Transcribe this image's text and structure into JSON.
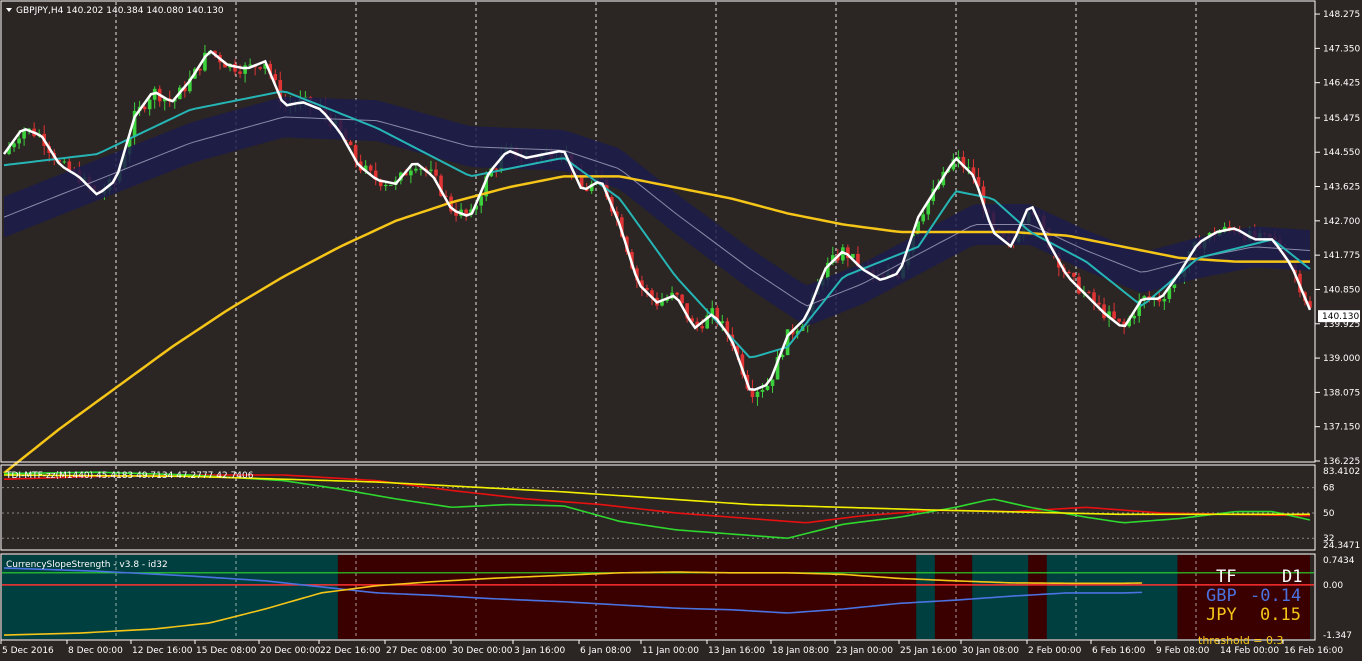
{
  "chart_data": [
    {
      "type": "candlestick",
      "pane": "main",
      "title": "GBPJPY,H4  140.202 140.384 140.080 140.130",
      "ylim": [
        136.225,
        148.6
      ],
      "yticks": [
        "148.275",
        "147.350",
        "146.425",
        "145.475",
        "144.550",
        "143.625",
        "142.700",
        "141.775",
        "140.850",
        "139.925",
        "139.000",
        "138.075",
        "137.150",
        "136.225"
      ],
      "yticks_values": [
        148.275,
        147.35,
        146.425,
        145.475,
        144.55,
        143.625,
        142.7,
        141.775,
        140.85,
        139.925,
        139.0,
        138.075,
        137.15,
        136.225
      ],
      "current_price": "140.130",
      "current_price_value": 140.13,
      "price_path": [
        [
          0,
          144.5
        ],
        [
          1,
          145.2
        ],
        [
          2,
          145.0
        ],
        [
          3,
          144.2
        ],
        [
          4,
          143.9
        ],
        [
          5,
          143.4
        ],
        [
          6,
          143.8
        ],
        [
          7,
          145.5
        ],
        [
          8,
          146.2
        ],
        [
          9,
          145.9
        ],
        [
          10,
          146.5
        ],
        [
          11,
          147.3
        ],
        [
          12,
          146.9
        ],
        [
          13,
          146.8
        ],
        [
          14,
          147.0
        ],
        [
          15,
          145.8
        ],
        [
          16,
          145.9
        ],
        [
          17,
          145.7
        ],
        [
          18,
          145.1
        ],
        [
          19,
          144.2
        ],
        [
          20,
          143.8
        ],
        [
          21,
          143.7
        ],
        [
          22,
          144.3
        ],
        [
          23,
          143.9
        ],
        [
          24,
          143.0
        ],
        [
          25,
          142.8
        ],
        [
          26,
          144.0
        ],
        [
          27,
          144.6
        ],
        [
          28,
          144.4
        ],
        [
          29,
          144.5
        ],
        [
          30,
          144.6
        ],
        [
          31,
          143.5
        ],
        [
          32,
          143.8
        ],
        [
          33,
          142.6
        ],
        [
          34,
          141.0
        ],
        [
          35,
          140.5
        ],
        [
          36,
          140.7
        ],
        [
          37,
          139.8
        ],
        [
          38,
          140.2
        ],
        [
          39,
          139.5
        ],
        [
          40,
          138.1
        ],
        [
          41,
          138.3
        ],
        [
          42,
          139.6
        ],
        [
          43,
          140.1
        ],
        [
          44,
          141.4
        ],
        [
          45,
          141.9
        ],
        [
          46,
          141.4
        ],
        [
          47,
          141.1
        ],
        [
          48,
          141.3
        ],
        [
          49,
          142.8
        ],
        [
          50,
          143.6
        ],
        [
          51,
          144.4
        ],
        [
          52,
          143.9
        ],
        [
          53,
          142.4
        ],
        [
          54,
          142.0
        ],
        [
          55,
          143.2
        ],
        [
          56,
          142.1
        ],
        [
          57,
          141.2
        ],
        [
          58,
          140.7
        ],
        [
          59,
          140.2
        ],
        [
          60,
          139.8
        ],
        [
          61,
          140.6
        ],
        [
          62,
          140.6
        ],
        [
          63,
          141.3
        ],
        [
          64,
          142.1
        ],
        [
          65,
          142.4
        ],
        [
          66,
          142.5
        ],
        [
          67,
          142.2
        ],
        [
          68,
          142.2
        ],
        [
          69,
          141.5
        ],
        [
          70,
          140.3
        ]
      ],
      "series": [
        {
          "values": [
            [
              0,
              144.2
            ],
            [
              5,
              144.5
            ],
            [
              10,
              145.7
            ],
            [
              15,
              146.2
            ],
            [
              20,
              145.2
            ],
            [
              25,
              143.9
            ],
            [
              30,
              144.4
            ],
            [
              33,
              143.3
            ],
            [
              36,
              141.2
            ],
            [
              40,
              139.0
            ],
            [
              42,
              139.3
            ],
            [
              45,
              141.2
            ],
            [
              49,
              142.0
            ],
            [
              51,
              143.5
            ],
            [
              53,
              143.3
            ],
            [
              55,
              142.4
            ],
            [
              58,
              141.6
            ],
            [
              61,
              140.4
            ],
            [
              64,
              141.7
            ],
            [
              68,
              142.2
            ],
            [
              70,
              141.4
            ]
          ],
          "color": "#26b5b5"
        },
        {
          "values": [
            [
              0,
              142.8
            ],
            [
              5,
              143.8
            ],
            [
              10,
              144.8
            ],
            [
              15,
              145.5
            ],
            [
              20,
              145.4
            ],
            [
              25,
              144.7
            ],
            [
              30,
              144.6
            ],
            [
              33,
              144.1
            ],
            [
              36,
              142.9
            ],
            [
              40,
              141.4
            ],
            [
              43,
              140.4
            ],
            [
              46,
              141.0
            ],
            [
              49,
              141.8
            ],
            [
              52,
              142.6
            ],
            [
              55,
              142.6
            ],
            [
              58,
              141.9
            ],
            [
              61,
              141.3
            ],
            [
              64,
              141.7
            ],
            [
              67,
              142.0
            ],
            [
              70,
              141.9
            ]
          ],
          "color": "#1c1c4c"
        },
        {
          "values": [
            [
              0,
              135.9
            ],
            [
              3,
              137.1
            ],
            [
              6,
              138.2
            ],
            [
              9,
              139.3
            ],
            [
              12,
              140.3
            ],
            [
              15,
              141.2
            ],
            [
              18,
              142.0
            ],
            [
              21,
              142.7
            ],
            [
              24,
              143.2
            ],
            [
              27,
              143.6
            ],
            [
              30,
              143.9
            ],
            [
              33,
              143.9
            ],
            [
              36,
              143.6
            ],
            [
              39,
              143.3
            ],
            [
              42,
              142.9
            ],
            [
              45,
              142.6
            ],
            [
              48,
              142.4
            ],
            [
              51,
              142.4
            ],
            [
              54,
              142.4
            ],
            [
              57,
              142.3
            ],
            [
              60,
              142.0
            ],
            [
              63,
              141.7
            ],
            [
              66,
              141.6
            ],
            [
              70,
              141.6
            ]
          ],
          "color": "#f5c518"
        }
      ],
      "xticks": [
        "5 Dec 2016",
        "8 Dec 00:00",
        "12 Dec 16:00",
        "15 Dec 08:00",
        "20 Dec 00:00",
        "22 Dec 16:00",
        "27 Dec 08:00",
        "30 Dec 00:00",
        "3 Jan 16:00",
        "6 Jan 08:00",
        "11 Jan 00:00",
        "13 Jan 16:00",
        "18 Jan 08:00",
        "23 Jan 00:00",
        "25 Jan 16:00",
        "30 Jan 08:00",
        "2 Feb 00:00",
        "6 Feb 16:00",
        "9 Feb 08:00",
        "14 Feb 00:00",
        "16 Feb 16:00"
      ]
    },
    {
      "type": "line",
      "pane": "indicator",
      "title": "TDI-MTF-zz(M1440) 45.4183 49.7134 47.2777 42.7406",
      "yticks": [
        "83.4102",
        "68",
        "50",
        "32",
        "24.3471"
      ],
      "yticks_values": [
        83.4102,
        68,
        50,
        32,
        24.3471
      ],
      "ylim": [
        24.3471,
        83.4102
      ],
      "series": [
        {
          "values": [
            [
              0,
              74
            ],
            [
              5,
              76
            ],
            [
              10,
              77
            ],
            [
              15,
              77
            ],
            [
              20,
              73
            ],
            [
              24,
              66
            ],
            [
              28,
              60
            ],
            [
              32,
              56
            ],
            [
              36,
              50
            ],
            [
              40,
              46
            ],
            [
              43,
              43
            ],
            [
              46,
              48
            ],
            [
              50,
              52
            ],
            [
              54,
              51
            ],
            [
              58,
              54
            ],
            [
              62,
              50
            ],
            [
              66,
              49
            ],
            [
              70,
              48
            ]
          ],
          "color": "#e81010"
        },
        {
          "values": [
            [
              0,
              78
            ],
            [
              5,
              79
            ],
            [
              10,
              77
            ],
            [
              15,
              73
            ],
            [
              18,
              67
            ],
            [
              21,
              60
            ],
            [
              24,
              54
            ],
            [
              27,
              56
            ],
            [
              30,
              55
            ],
            [
              33,
              44
            ],
            [
              36,
              38
            ],
            [
              40,
              34
            ],
            [
              42,
              32
            ],
            [
              45,
              42
            ],
            [
              48,
              47
            ],
            [
              51,
              54
            ],
            [
              53,
              60
            ],
            [
              55,
              54
            ],
            [
              58,
              47
            ],
            [
              60,
              43
            ],
            [
              63,
              46
            ],
            [
              66,
              51
            ],
            [
              68,
              51
            ],
            [
              70,
              45
            ]
          ],
          "color": "#2ed82e"
        },
        {
          "values": [
            [
              0,
              77
            ],
            [
              10,
              76
            ],
            [
              20,
              72
            ],
            [
              30,
              65
            ],
            [
              40,
              56
            ],
            [
              50,
              52
            ],
            [
              60,
              49
            ],
            [
              70,
              49
            ]
          ],
          "color": "#f2f000"
        }
      ]
    },
    {
      "type": "line",
      "pane": "currency-slope",
      "title": "CurrencySlopeStrength - v3.8 - id32",
      "yticks": [
        "0.7434",
        "0.00",
        "-1.347"
      ],
      "yticks_values": [
        0.7434,
        0.0,
        -1.347
      ],
      "ylim": [
        -1.347,
        0.7434
      ],
      "threshold": 0.3,
      "series": [
        {
          "values": [
            [
              0,
              0.42
            ],
            [
              5,
              0.34
            ],
            [
              10,
              0.22
            ],
            [
              14,
              0.1
            ],
            [
              17,
              -0.05
            ],
            [
              20,
              -0.2
            ],
            [
              23,
              -0.26
            ],
            [
              26,
              -0.34
            ],
            [
              30,
              -0.42
            ],
            [
              33,
              -0.5
            ],
            [
              36,
              -0.58
            ],
            [
              39,
              -0.62
            ],
            [
              42,
              -0.7
            ],
            [
              45,
              -0.6
            ],
            [
              48,
              -0.46
            ],
            [
              51,
              -0.38
            ],
            [
              54,
              -0.28
            ],
            [
              57,
              -0.2
            ],
            [
              60,
              -0.2
            ],
            [
              63,
              -0.16
            ],
            [
              66,
              -0.18
            ],
            [
              70,
              -0.22
            ]
          ],
          "color": "#4a72e0"
        },
        {
          "values": [
            [
              0,
              -1.25
            ],
            [
              4,
              -1.2
            ],
            [
              8,
              -1.1
            ],
            [
              11,
              -0.95
            ],
            [
              14,
              -0.6
            ],
            [
              17,
              -0.2
            ],
            [
              20,
              -0.02
            ],
            [
              23,
              0.08
            ],
            [
              26,
              0.16
            ],
            [
              30,
              0.24
            ],
            [
              33,
              0.3
            ],
            [
              36,
              0.32
            ],
            [
              39,
              0.3
            ],
            [
              42,
              0.3
            ],
            [
              45,
              0.26
            ],
            [
              48,
              0.16
            ],
            [
              51,
              0.1
            ],
            [
              54,
              0.05
            ],
            [
              57,
              0.04
            ],
            [
              60,
              0.04
            ],
            [
              63,
              0.06
            ],
            [
              66,
              0.1
            ],
            [
              70,
              0.12
            ]
          ],
          "color": "#f5c518"
        }
      ],
      "legend": {
        "tf_label": "TF",
        "tf_value": "D1",
        "rows": [
          {
            "currency": "GBP",
            "value": "-0.14",
            "color": "#4a72e0"
          },
          {
            "currency": "JPY",
            "value": "0.15",
            "color": "#f5c518"
          }
        ],
        "threshold_text": "threshold = 0.3"
      },
      "zones": [
        {
          "from": 0,
          "to": 18,
          "state": "teal"
        },
        {
          "from": 18,
          "to": 49,
          "state": "dark-red"
        },
        {
          "from": 49,
          "to": 50,
          "state": "teal"
        },
        {
          "from": 50,
          "to": 52,
          "state": "dark-red"
        },
        {
          "from": 52,
          "to": 55,
          "state": "teal"
        },
        {
          "from": 55,
          "to": 56,
          "state": "dark-red"
        },
        {
          "from": 56,
          "to": 63,
          "state": "teal"
        },
        {
          "from": 63,
          "to": 70,
          "state": "dark-red"
        }
      ]
    }
  ],
  "colors": {
    "background": "#2b2523",
    "bull": "#3cd13c",
    "bear": "#e03434",
    "grid": "#ffffff",
    "teal_zone": "#003f3f",
    "red_zone": "#3a0000"
  }
}
